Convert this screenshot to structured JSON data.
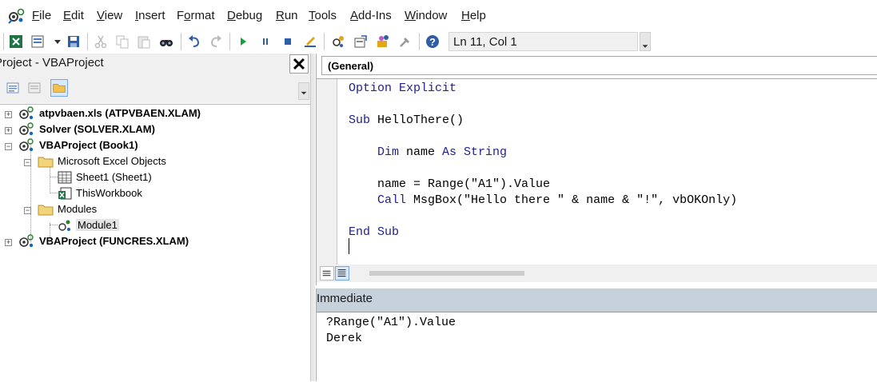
{
  "menu": {
    "items": [
      {
        "pre": "",
        "ul": "F",
        "post": "ile"
      },
      {
        "pre": "",
        "ul": "E",
        "post": "dit"
      },
      {
        "pre": "",
        "ul": "V",
        "post": "iew"
      },
      {
        "pre": "",
        "ul": "I",
        "post": "nsert"
      },
      {
        "pre": "F",
        "ul": "o",
        "post": "rmat"
      },
      {
        "pre": "",
        "ul": "D",
        "post": "ebug"
      },
      {
        "pre": "",
        "ul": "R",
        "post": "un"
      },
      {
        "pre": "",
        "ul": "T",
        "post": "ools"
      },
      {
        "pre": "",
        "ul": "A",
        "post": "dd-Ins"
      },
      {
        "pre": "",
        "ul": "W",
        "post": "indow"
      },
      {
        "pre": "",
        "ul": "H",
        "post": "elp"
      }
    ]
  },
  "toolbar": {
    "status": "Ln 11, Col 1"
  },
  "project": {
    "title": "Project - VBAProject",
    "close": "✕",
    "tree": [
      {
        "label": "atpvbaen.xls (ATPVBAEN.XLAM)",
        "bold": true
      },
      {
        "label": "Solver (SOLVER.XLAM)",
        "bold": true
      },
      {
        "label": "VBAProject (Book1)",
        "bold": true
      },
      {
        "label": "Microsoft Excel Objects",
        "bold": false
      },
      {
        "label": "Sheet1 (Sheet1)",
        "bold": false
      },
      {
        "label": "ThisWorkbook",
        "bold": false
      },
      {
        "label": "Modules",
        "bold": false
      },
      {
        "label": "Module1",
        "bold": false
      },
      {
        "label": "VBAProject (FUNCRES.XLAM)",
        "bold": true
      }
    ]
  },
  "code": {
    "object_combo": "(General)",
    "lines": [
      {
        "kw": "Option Explicit",
        "rest": ""
      },
      {
        "kw": "",
        "rest": ""
      },
      {
        "kw": "Sub",
        "rest": " HelloThere()"
      },
      {
        "kw": "",
        "rest": ""
      },
      {
        "kw": "",
        "rest": "    ",
        "kw2": "Dim",
        "mid": " name ",
        "kw3": "As String"
      },
      {
        "kw": "",
        "rest": ""
      },
      {
        "kw": "",
        "rest": "    name = Range(\"A1\").Value"
      },
      {
        "kw": "",
        "rest": "    ",
        "kw2": "Call",
        "mid": " MsgBox(\"Hello there \" & name & \"!\", vbOKOnly)"
      },
      {
        "kw": "",
        "rest": ""
      },
      {
        "kw": "End Sub",
        "rest": ""
      }
    ]
  },
  "immediate": {
    "title": "Immediate",
    "lines": [
      "?Range(\"A1\").Value",
      "Derek"
    ]
  },
  "colors": {
    "keyword": "#1f1f8f",
    "immediate_header": "#c7d1dc"
  }
}
